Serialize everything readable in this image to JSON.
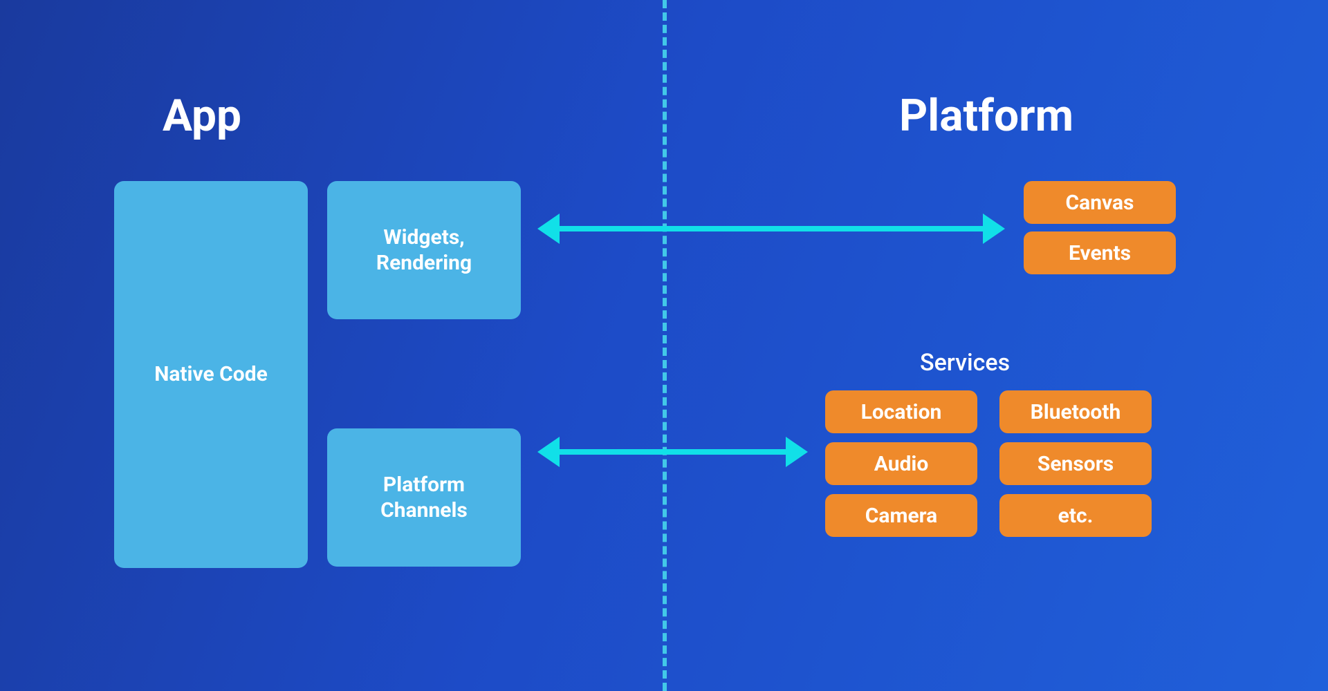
{
  "headings": {
    "app": "App",
    "platform": "Platform"
  },
  "app": {
    "native_code": "Native Code",
    "widgets_rendering": "Widgets,\nRendering",
    "platform_channels": "Platform\nChannels"
  },
  "platform": {
    "canvas": "Canvas",
    "events": "Events",
    "services_label": "Services",
    "services": {
      "location": "Location",
      "audio": "Audio",
      "camera": "Camera",
      "bluetooth": "Bluetooth",
      "sensors": "Sensors",
      "etc": "etc."
    }
  }
}
